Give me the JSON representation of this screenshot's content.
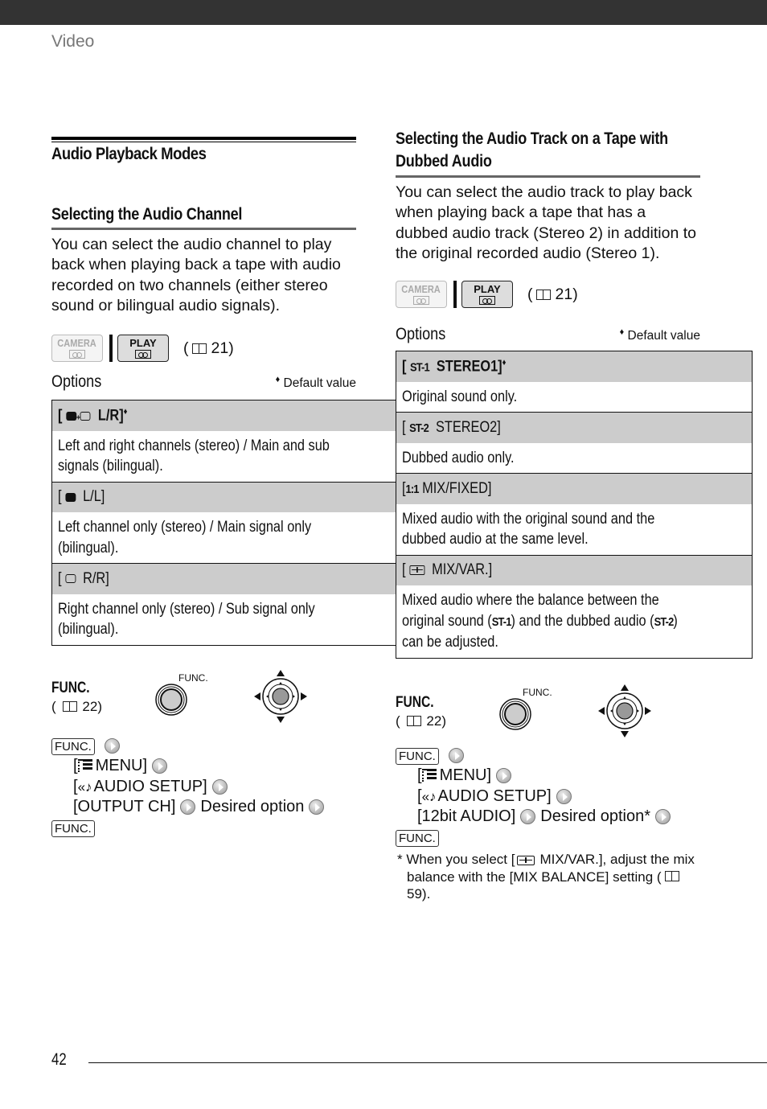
{
  "header": {
    "section": "Video"
  },
  "left": {
    "title": "Audio Playback Modes",
    "subtitle": "Selecting the Audio Channel",
    "intro": "You can select the audio channel to play back when playing back a tape with audio recorded on two channels (either stereo sound or bilingual audio signals).",
    "modes": {
      "camera": "CAMERA",
      "play": "PLAY",
      "ref": "21"
    },
    "options_title": "Options",
    "default_note": "Default value",
    "options": [
      {
        "icon": "bubble-filled-plus-open-icon",
        "label": "L/R]",
        "default": true,
        "desc": "Left and right channels (stereo) / Main and sub signals (bilingual)."
      },
      {
        "icon": "bubble-filled-icon",
        "label": "L/L]",
        "default": false,
        "desc": "Left channel only (stereo) / Main signal only (bilingual)."
      },
      {
        "icon": "bubble-open-icon",
        "label": "R/R]",
        "default": false,
        "desc": "Right channel only (stereo) / Sub signal only (bilingual)."
      }
    ],
    "func": {
      "label": "FUNC.",
      "ref": "22",
      "button_label": "FUNC."
    },
    "steps": {
      "func_key": "FUNC.",
      "menu": "MENU]",
      "audio_setup": "AUDIO SETUP]",
      "setting": "[OUTPUT CH]",
      "desired": "Desired option"
    }
  },
  "right": {
    "subtitle_line1": "Selecting the Audio Track on a Tape with",
    "subtitle_line2": "Dubbed Audio",
    "intro": "You can select the audio track to play back when playing back a tape that has a dubbed audio track (Stereo 2) in addition to the original recorded audio (Stereo 1).",
    "modes": {
      "camera": "CAMERA",
      "play": "PLAY",
      "ref": "21"
    },
    "options_title": "Options",
    "default_note": "Default value",
    "options": [
      {
        "badge": "ST-1",
        "label": "STEREO1]",
        "default": true,
        "desc": "Original sound only."
      },
      {
        "badge": "ST-2",
        "label": "STEREO2]",
        "default": false,
        "desc": "Dubbed audio only."
      },
      {
        "badge": "1:1",
        "label": "MIX/FIXED]",
        "default": false,
        "desc": "Mixed audio with the original sound and the dubbed audio at the same level."
      },
      {
        "badge": "mix-var-icon",
        "label": "MIX/VAR.]",
        "default": false,
        "desc_a": "Mixed audio where the balance between the original sound (",
        "desc_b": ") and the dubbed audio (",
        "desc_c": ") can be adjusted.",
        "badge_a": "ST-1",
        "badge_b": "ST-2"
      }
    ],
    "func": {
      "label": "FUNC.",
      "ref": "22",
      "button_label": "FUNC."
    },
    "steps": {
      "func_key": "FUNC.",
      "menu": "MENU]",
      "audio_setup": "AUDIO SETUP]",
      "setting": "[12bit AUDIO]",
      "desired": "Desired option*"
    },
    "footnote": {
      "a": "* When you select [",
      "b": "MIX/VAR.], adjust the mix balance with the [MIX BALANCE] setting (",
      "ref": "59",
      "c": ")."
    }
  },
  "footer": {
    "page": "42"
  }
}
